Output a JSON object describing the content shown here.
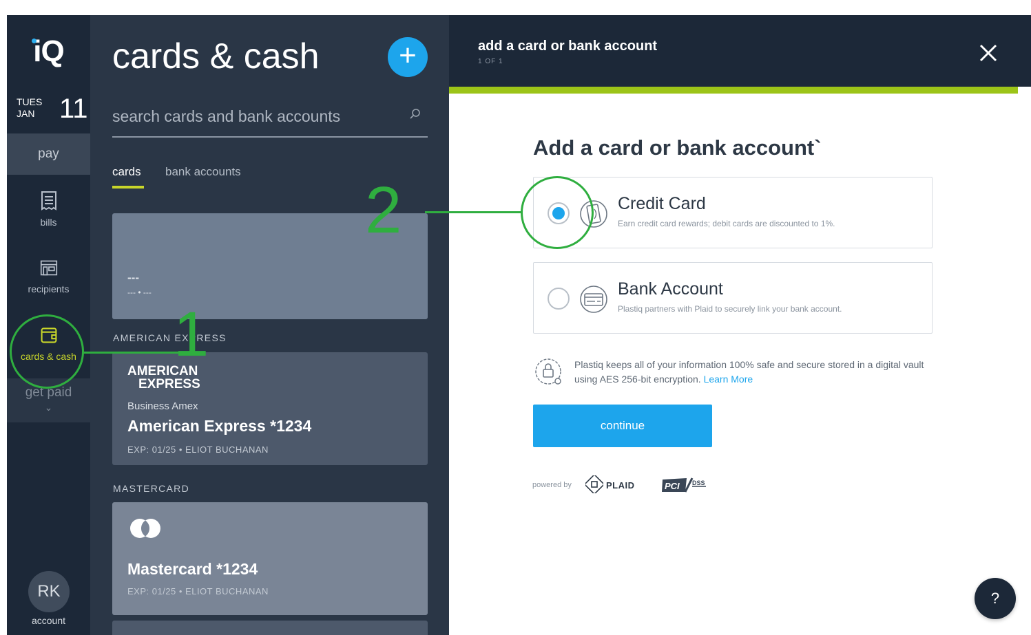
{
  "rail": {
    "logo": "iQ",
    "date": {
      "dow": "TUES",
      "month": "JAN",
      "day": "11"
    },
    "pay_label": "pay",
    "items": [
      {
        "label": "bills",
        "icon": "receipt-icon"
      },
      {
        "label": "recipients",
        "icon": "storefront-icon"
      },
      {
        "label": "cards & cash",
        "icon": "wallet-icon"
      }
    ],
    "get_paid_label": "get paid",
    "avatar_initials": "RK",
    "account_label": "account"
  },
  "list_panel": {
    "title": "cards & cash",
    "add_button": "+",
    "search_placeholder": "search cards and bank accounts",
    "tabs": [
      "cards",
      "bank accounts"
    ],
    "active_tab": "cards",
    "blank_card": {
      "line1": "---",
      "line2": "--- • ---"
    },
    "groups": [
      {
        "label": "AMERICAN EXPRESS",
        "card": {
          "logo_line1": "AMERICAN",
          "logo_line2": "EXPRESS",
          "subtitle": "Business Amex",
          "name": "American Express *1234",
          "exp": "EXP: 01/25 • ELIOT BUCHANAN"
        }
      },
      {
        "label": "MASTERCARD",
        "card": {
          "name": "Mastercard *1234",
          "exp": "EXP: 01/25 • ELIOT BUCHANAN"
        }
      }
    ]
  },
  "modal": {
    "title": "add a card or bank account",
    "step": "1 OF 1",
    "close_icon": "close-icon",
    "form_title": "Add a card or bank account`",
    "options": [
      {
        "title": "Credit Card",
        "description": "Earn credit card rewards; debit cards are discounted to 1%.",
        "selected": true,
        "icon": "contactless-card-icon"
      },
      {
        "title": "Bank Account",
        "description": "Plastiq partners with Plaid to securely link your bank account.",
        "selected": false,
        "icon": "bank-card-icon"
      }
    ],
    "security_text": "Plastiq keeps all of your information 100% safe and secure stored in a digital vault using AES 256-bit encryption.",
    "learn_more": "Learn More",
    "continue_label": "continue",
    "powered_by": "powered by",
    "plaid_label": "PLAID",
    "help_label": "?"
  },
  "annotations": [
    "1",
    "2"
  ],
  "colors": {
    "accent_blue": "#1da5ec",
    "accent_green": "#9cc418",
    "annotation_green": "#2fae3f",
    "dark_navy": "#1c2838"
  }
}
